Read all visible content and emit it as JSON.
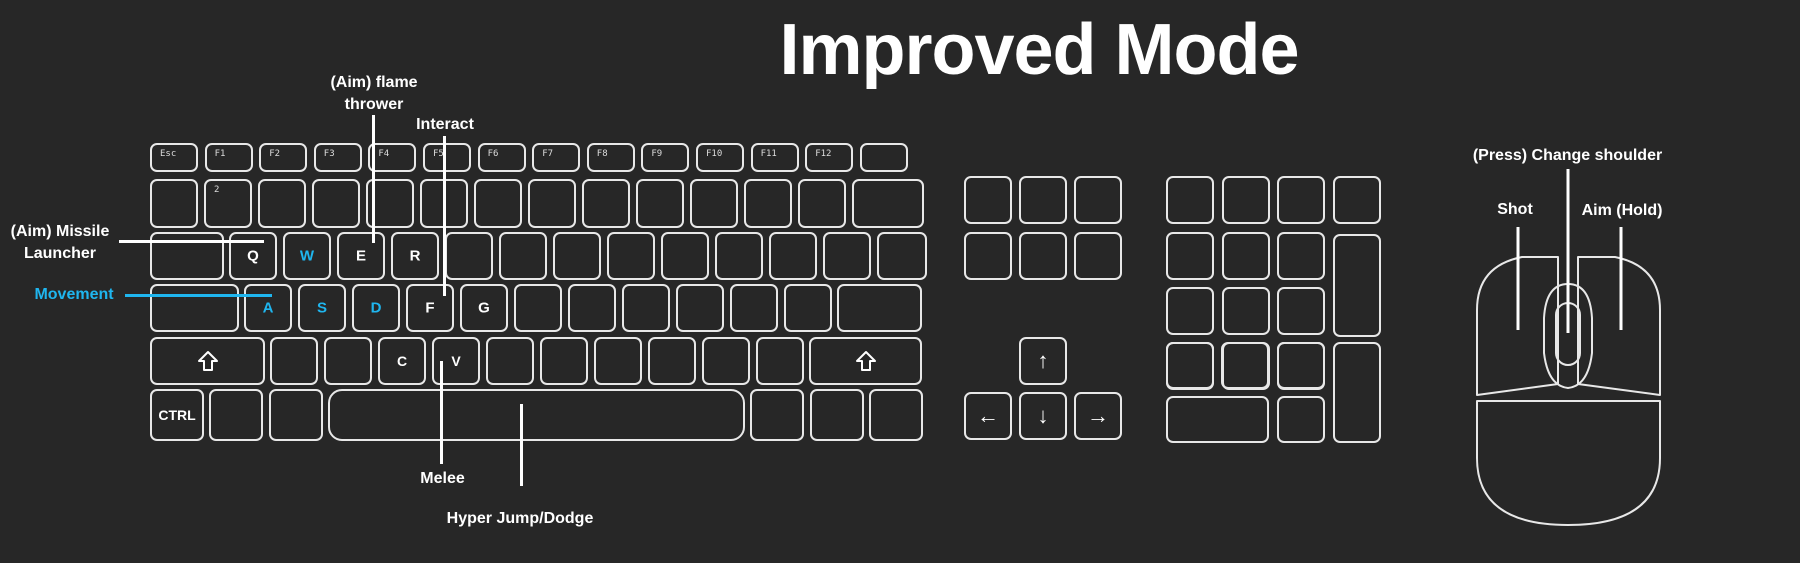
{
  "title": "Improved Mode",
  "colors": {
    "background": "#272727",
    "outline": "#e8e8e8",
    "accent": "#1fb6ef",
    "text": "#ffffff"
  },
  "keyboard": {
    "keys": {
      "esc": "Esc",
      "f1": "F1",
      "f2": "F2",
      "f3": "F3",
      "f4": "F4",
      "f5": "F5",
      "f6": "F6",
      "f7": "F7",
      "f8": "F8",
      "f9": "F9",
      "f10": "F10",
      "f11": "F11",
      "f12": "F12",
      "num2": "2",
      "q": "Q",
      "w": "W",
      "e": "E",
      "r": "R",
      "a": "A",
      "s": "S",
      "d": "D",
      "f": "F",
      "g": "G",
      "c": "C",
      "v": "V",
      "ctrl": "CTRL"
    },
    "shift_icon": "shift-arrow",
    "arrows": {
      "up": "↑",
      "down": "↓",
      "left": "←",
      "right": "→"
    },
    "movement_keys": [
      "W",
      "A",
      "S",
      "D"
    ]
  },
  "labels": {
    "missile": "(Aim) Missile Launcher",
    "movement": "Movement",
    "flame": "(Aim) flame thrower",
    "interact": "Interact",
    "melee": "Melee",
    "hyperjump": "Hyper Jump/Dodge",
    "press_shoulder": "(Press) Change shoulder",
    "shot": "Shot",
    "aim_hold": "Aim (Hold)"
  }
}
